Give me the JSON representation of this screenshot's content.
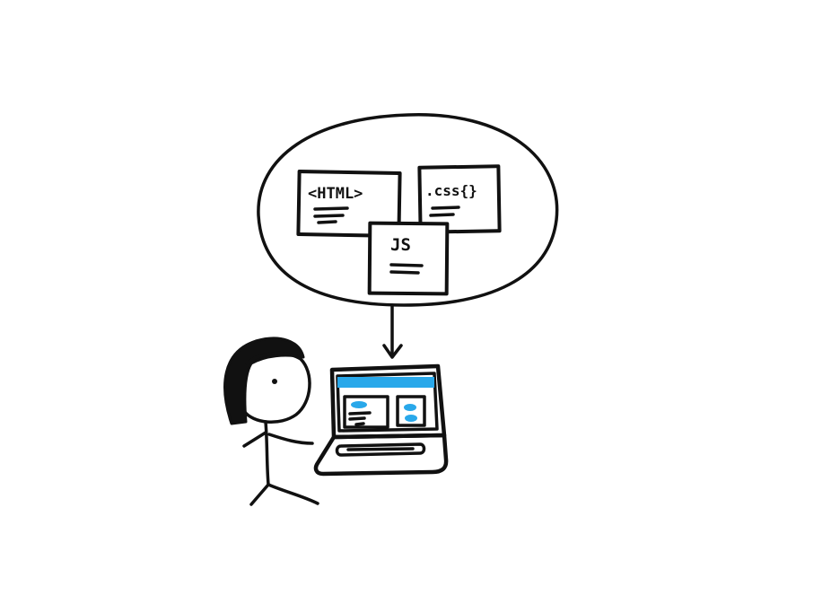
{
  "cards": {
    "html_label": "<HTML>",
    "css_label": ".css{}",
    "js_label": "JS"
  },
  "colors": {
    "ink": "#111111",
    "screen_accent": "#29a8ea",
    "background": "#ffffff"
  }
}
